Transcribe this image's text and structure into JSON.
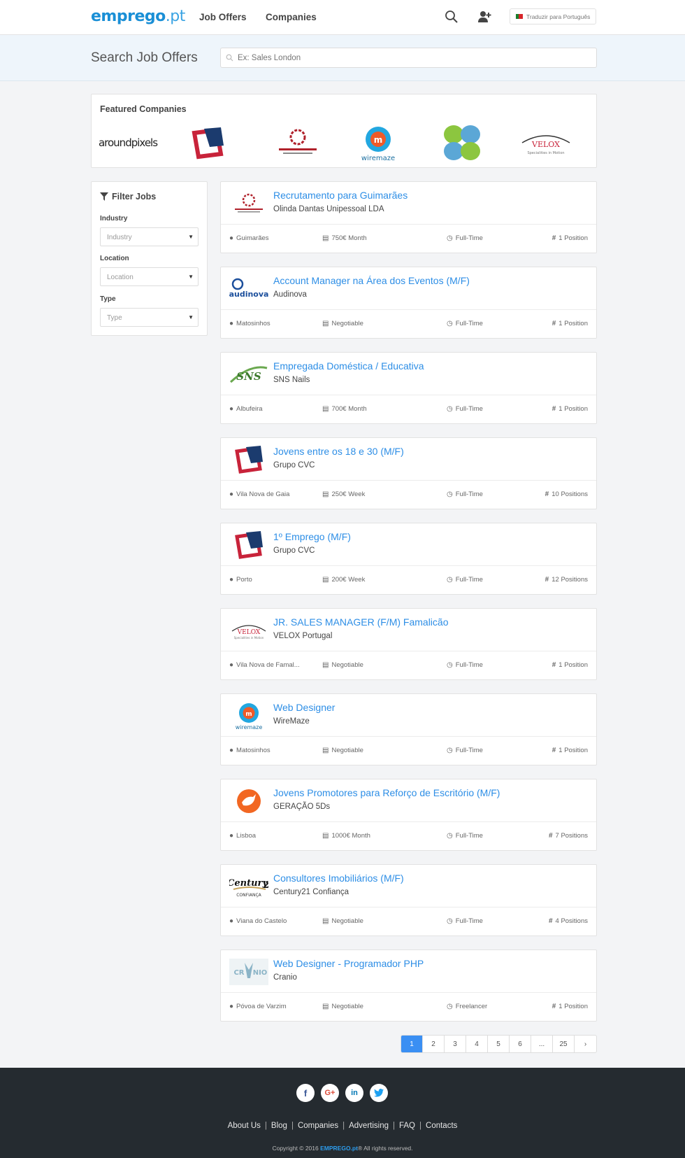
{
  "header": {
    "logo_main": "emprego",
    "logo_tld": ".pt",
    "nav": [
      "Job Offers",
      "Companies"
    ],
    "translate": "Traduzir para Português"
  },
  "search": {
    "title": "Search Job Offers",
    "placeholder": "Ex: Sales London"
  },
  "featured": {
    "title": "Featured Companies",
    "companies": [
      "aroundpixels",
      "Grupo CVC",
      "Olinda Dantas Unipessoal LDA",
      "wiremaze",
      "Caravela",
      "VELOX"
    ]
  },
  "filter": {
    "title": "Filter Jobs",
    "fields": [
      {
        "label": "Industry",
        "value": "Industry"
      },
      {
        "label": "Location",
        "value": "Location"
      },
      {
        "label": "Type",
        "value": "Type"
      }
    ]
  },
  "jobs": [
    {
      "title": "Recrutamento para Guimarães",
      "company": "Olinda Dantas Unipessoal LDA",
      "location": "Guimarães",
      "salary": "750€ Month",
      "type": "Full-Time",
      "positions": "1 Position",
      "logo": "olinda"
    },
    {
      "title": "Account Manager na Área dos Eventos (M/F)",
      "company": "Audinova",
      "location": "Matosinhos",
      "salary": "Negotiable",
      "type": "Full-Time",
      "positions": "1 Position",
      "logo": "audinova"
    },
    {
      "title": "Empregada Doméstica / Educativa",
      "company": "SNS Nails",
      "location": "Albufeira",
      "salary": "700€ Month",
      "type": "Full-Time",
      "positions": "1 Position",
      "logo": "sns"
    },
    {
      "title": "Jovens entre os 18 e 30 (M/F)",
      "company": "Grupo CVC",
      "location": "Vila Nova de Gaia",
      "salary": "250€ Week",
      "type": "Full-Time",
      "positions": "10 Positions",
      "logo": "cvc"
    },
    {
      "title": "1º Emprego (M/F)",
      "company": "Grupo CVC",
      "location": "Porto",
      "salary": "200€ Week",
      "type": "Full-Time",
      "positions": "12 Positions",
      "logo": "cvc"
    },
    {
      "title": "JR. SALES MANAGER (F/M) Famalicão",
      "company": "VELOX Portugal",
      "location": "Vila Nova de Famal...",
      "salary": "Negotiable",
      "type": "Full-Time",
      "positions": "1 Position",
      "logo": "velox"
    },
    {
      "title": "Web Designer",
      "company": "WireMaze",
      "location": "Matosinhos",
      "salary": "Negotiable",
      "type": "Full-Time",
      "positions": "1 Position",
      "logo": "wiremaze"
    },
    {
      "title": "Jovens Promotores para Reforço de Escritório (M/F)",
      "company": "GERAÇÃO 5Ds",
      "location": "Lisboa",
      "salary": "1000€ Month",
      "type": "Full-Time",
      "positions": "7 Positions",
      "logo": "geracao"
    },
    {
      "title": "Consultores Imobiliários (M/F)",
      "company": "Century21 Confiança",
      "location": "Viana do Castelo",
      "salary": "Negotiable",
      "type": "Full-Time",
      "positions": "4 Positions",
      "logo": "century21"
    },
    {
      "title": "Web Designer - Programador PHP",
      "company": "Cranio",
      "location": "Póvoa de Varzim",
      "salary": "Negotiable",
      "type": "Freelancer",
      "positions": "1 Position",
      "logo": "cranio"
    }
  ],
  "pagination": {
    "pages": [
      "1",
      "2",
      "3",
      "4",
      "5",
      "6",
      "...",
      "25",
      "›"
    ],
    "active": "1"
  },
  "footer": {
    "social": [
      "facebook-icon",
      "google-plus-icon",
      "linkedin-icon",
      "twitter-icon"
    ],
    "links": [
      "About Us",
      "Blog",
      "Companies",
      "Advertising",
      "FAQ",
      "Contacts"
    ],
    "copyright_pre": "Copyright © 2016",
    "copyright_brand": "EMPREGO.pt",
    "copyright_post": "® All rights reserved."
  },
  "colors": {
    "accent": "#2d8ee6",
    "brand": "#1a8fd6",
    "footer": "#252b30",
    "active_page": "#3a8ff3"
  }
}
